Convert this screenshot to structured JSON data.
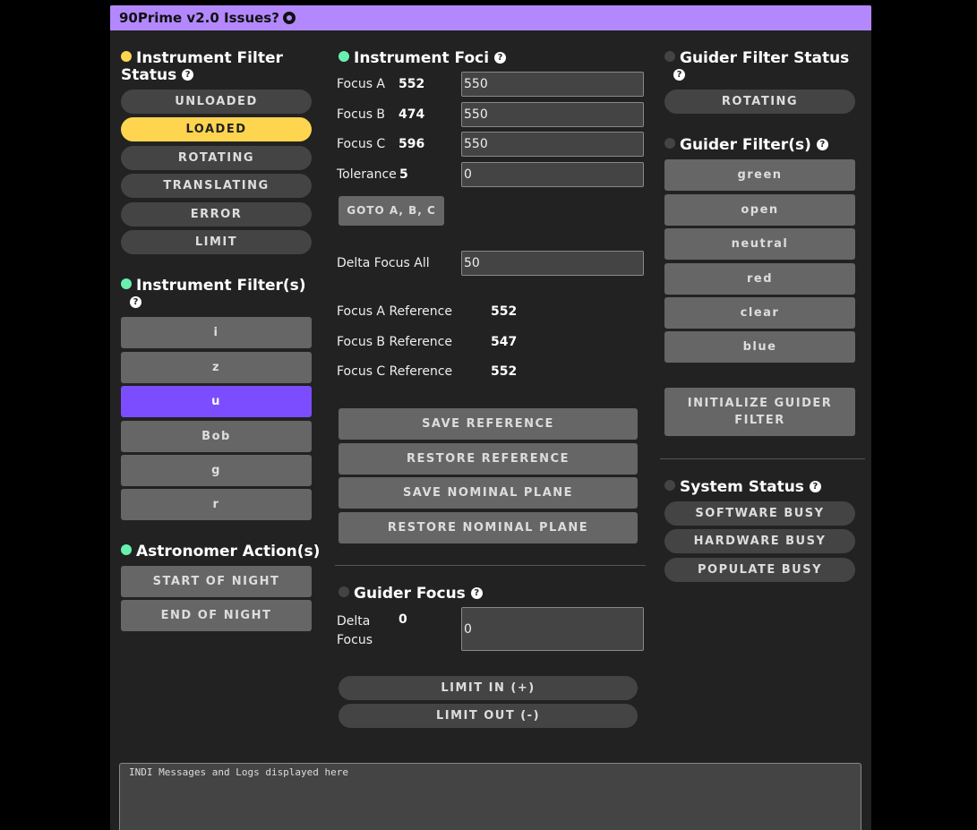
{
  "header": {
    "title": "90Prime v2.0 Issues?",
    "icon": "github-icon"
  },
  "colors": {
    "accent": "#b388ff",
    "loaded": "#ffd54f",
    "selected_filter": "#7c4dff",
    "ok_dot": "#69f0ae",
    "idle_dot": "#444444"
  },
  "instrument_filter_status": {
    "title": "Instrument Filter Status",
    "help": "?",
    "states": [
      "UNLOADED",
      "LOADED",
      "ROTATING",
      "TRANSLATING",
      "ERROR",
      "LIMIT"
    ],
    "active": "LOADED"
  },
  "instrument_filters": {
    "title": "Instrument Filter(s)",
    "help": "?",
    "items": [
      "i",
      "z",
      "u",
      "Bob",
      "g",
      "r"
    ],
    "selected": "u"
  },
  "astronomer_actions": {
    "title": "Astronomer Action(s)",
    "items": [
      "START OF NIGHT",
      "END OF NIGHT"
    ]
  },
  "instrument_foci": {
    "title": "Instrument Foci",
    "help": "?",
    "rows": [
      {
        "label": "Focus A",
        "current": "552",
        "input": "550"
      },
      {
        "label": "Focus B",
        "current": "474",
        "input": "550"
      },
      {
        "label": "Focus C",
        "current": "596",
        "input": "550"
      },
      {
        "label": "Tolerance",
        "current": "5",
        "input": "0"
      }
    ],
    "goto_label": "GOTO A, B, C",
    "delta_label": "Delta Focus All",
    "delta_value": "50",
    "references": [
      {
        "label": "Focus A Reference",
        "value": "552"
      },
      {
        "label": "Focus B Reference",
        "value": "547"
      },
      {
        "label": "Focus C Reference",
        "value": "552"
      }
    ],
    "buttons": [
      "SAVE REFERENCE",
      "RESTORE REFERENCE",
      "SAVE NOMINAL PLANE",
      "RESTORE NOMINAL PLANE"
    ]
  },
  "guider_focus": {
    "title": "Guider Focus",
    "help": "?",
    "delta_label_1": "Delta",
    "delta_label_2": "Focus",
    "delta_current": "0",
    "delta_input": "0",
    "limit_in": "LIMIT IN (+)",
    "limit_out": "LIMIT OUT (-)"
  },
  "guider_filter_status": {
    "title": "Guider Filter Status",
    "help": "?",
    "state": "ROTATING"
  },
  "guider_filters": {
    "title": "Guider Filter(s)",
    "help": "?",
    "items": [
      "green",
      "open",
      "neutral",
      "red",
      "clear",
      "blue"
    ],
    "initialize_label": "INITIALIZE GUIDER FILTER"
  },
  "system_status": {
    "title": "System Status",
    "help": "?",
    "states": [
      "SOFTWARE BUSY",
      "HARDWARE BUSY",
      "POPULATE BUSY"
    ]
  },
  "log": {
    "placeholder": "INDI Messages and Logs displayed here"
  }
}
